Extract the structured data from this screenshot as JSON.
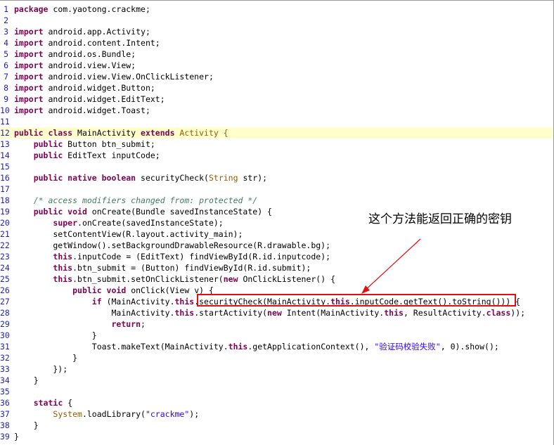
{
  "editor": {
    "lines": [
      {
        "n": "1",
        "parts": [
          [
            "kw",
            "package"
          ],
          [
            "pl",
            " com.yaotong.crackme;"
          ]
        ]
      },
      {
        "n": "2",
        "parts": []
      },
      {
        "n": "3",
        "parts": [
          [
            "kw",
            "import"
          ],
          [
            "pl",
            " android.app.Activity;"
          ]
        ]
      },
      {
        "n": "4",
        "parts": [
          [
            "kw",
            "import"
          ],
          [
            "pl",
            " android.content.Intent;"
          ]
        ]
      },
      {
        "n": "5",
        "parts": [
          [
            "kw",
            "import"
          ],
          [
            "pl",
            " android.os.Bundle;"
          ]
        ]
      },
      {
        "n": "6",
        "parts": [
          [
            "kw",
            "import"
          ],
          [
            "pl",
            " android.view.View;"
          ]
        ]
      },
      {
        "n": "7",
        "parts": [
          [
            "kw",
            "import"
          ],
          [
            "pl",
            " android.view.View.OnClickListener;"
          ]
        ]
      },
      {
        "n": "8",
        "parts": [
          [
            "kw",
            "import"
          ],
          [
            "pl",
            " android.widget.Button;"
          ]
        ]
      },
      {
        "n": "9",
        "parts": [
          [
            "kw",
            "import"
          ],
          [
            "pl",
            " android.widget.EditText;"
          ]
        ]
      },
      {
        "n": "10",
        "parts": [
          [
            "kw",
            "import"
          ],
          [
            "pl",
            " android.widget.Toast;"
          ]
        ]
      },
      {
        "n": "11",
        "parts": []
      },
      {
        "n": "12",
        "hl": true,
        "parts": [
          [
            "kw",
            "public class"
          ],
          [
            "pl",
            " MainActivity "
          ],
          [
            "kw",
            "extends"
          ],
          [
            "an",
            " Activity {"
          ]
        ]
      },
      {
        "n": "13",
        "parts": [
          [
            "pl",
            "    "
          ],
          [
            "kw",
            "public"
          ],
          [
            "pl",
            " Button btn_submit;"
          ]
        ]
      },
      {
        "n": "14",
        "parts": [
          [
            "pl",
            "    "
          ],
          [
            "kw",
            "public"
          ],
          [
            "pl",
            " EditText inputCode;"
          ]
        ]
      },
      {
        "n": "15",
        "parts": []
      },
      {
        "n": "16",
        "parts": [
          [
            "pl",
            "    "
          ],
          [
            "kw",
            "public native boolean"
          ],
          [
            "pl",
            " securityCheck("
          ],
          [
            "an",
            "String"
          ],
          [
            "pl",
            " str);"
          ]
        ]
      },
      {
        "n": "17",
        "parts": []
      },
      {
        "n": "18",
        "parts": [
          [
            "pl",
            "    "
          ],
          [
            "cm",
            "/* access modifiers changed from: protected */"
          ]
        ]
      },
      {
        "n": "19",
        "parts": [
          [
            "pl",
            "    "
          ],
          [
            "kw",
            "public void"
          ],
          [
            "pl",
            " onCreate(Bundle savedInstanceState) {"
          ]
        ]
      },
      {
        "n": "20",
        "parts": [
          [
            "pl",
            "        "
          ],
          [
            "kw",
            "super"
          ],
          [
            "pl",
            ".onCreate(savedInstanceState);"
          ]
        ]
      },
      {
        "n": "21",
        "parts": [
          [
            "pl",
            "        setContentView(R.layout.activity_main);"
          ]
        ]
      },
      {
        "n": "22",
        "parts": [
          [
            "pl",
            "        getWindow().setBackgroundDrawableResource(R.drawable.bg);"
          ]
        ]
      },
      {
        "n": "23",
        "parts": [
          [
            "pl",
            "        "
          ],
          [
            "kw",
            "this"
          ],
          [
            "pl",
            ".inputCode = (EditText) findViewById(R.id.inputcode);"
          ]
        ]
      },
      {
        "n": "24",
        "parts": [
          [
            "pl",
            "        "
          ],
          [
            "kw",
            "this"
          ],
          [
            "pl",
            ".btn_submit = (Button) findViewById(R.id.submit);"
          ]
        ]
      },
      {
        "n": "25",
        "parts": [
          [
            "pl",
            "        "
          ],
          [
            "kw",
            "this"
          ],
          [
            "pl",
            ".btn_submit.setOnClickListener("
          ],
          [
            "kw",
            "new"
          ],
          [
            "pl",
            " OnClickListener() {"
          ]
        ]
      },
      {
        "n": "26",
        "parts": [
          [
            "pl",
            "            "
          ],
          [
            "kw",
            "public void"
          ],
          [
            "pl",
            " onClick(View v) {"
          ]
        ]
      },
      {
        "n": "27",
        "parts": [
          [
            "pl",
            "                "
          ],
          [
            "kw",
            "if"
          ],
          [
            "pl",
            " (MainActivity."
          ],
          [
            "kw",
            "this"
          ],
          [
            "pl",
            ".securityCheck(MainActivity."
          ],
          [
            "kw",
            "this"
          ],
          [
            "pl",
            ".inputCode.getText().toString())) {"
          ]
        ]
      },
      {
        "n": "28",
        "parts": [
          [
            "pl",
            "                    MainActivity."
          ],
          [
            "kw",
            "this"
          ],
          [
            "pl",
            ".startActivity("
          ],
          [
            "kw",
            "new"
          ],
          [
            "pl",
            " Intent(MainActivity."
          ],
          [
            "kw",
            "this"
          ],
          [
            "pl",
            ", ResultActivity."
          ],
          [
            "kw",
            "class"
          ],
          [
            "pl",
            "));"
          ]
        ]
      },
      {
        "n": "29",
        "parts": [
          [
            "pl",
            "                    "
          ],
          [
            "kw",
            "return"
          ],
          [
            "pl",
            ";"
          ]
        ]
      },
      {
        "n": "30",
        "parts": [
          [
            "pl",
            "                }"
          ]
        ]
      },
      {
        "n": "31",
        "parts": [
          [
            "pl",
            "                Toast.makeText(MainActivity."
          ],
          [
            "kw",
            "this"
          ],
          [
            "pl",
            ".getApplicationContext(), "
          ],
          [
            "st",
            "\"验证码校验失败\""
          ],
          [
            "pl",
            ", 0).show();"
          ]
        ]
      },
      {
        "n": "32",
        "parts": [
          [
            "pl",
            "            }"
          ]
        ]
      },
      {
        "n": "33",
        "parts": [
          [
            "pl",
            "        });"
          ]
        ]
      },
      {
        "n": "34",
        "parts": [
          [
            "pl",
            "    }"
          ]
        ]
      },
      {
        "n": "35",
        "parts": []
      },
      {
        "n": "36",
        "parts": [
          [
            "pl",
            "    "
          ],
          [
            "kw",
            "static"
          ],
          [
            "pl",
            " {"
          ]
        ]
      },
      {
        "n": "37",
        "parts": [
          [
            "pl",
            "        "
          ],
          [
            "an",
            "System"
          ],
          [
            "pl",
            ".loadLibrary("
          ],
          [
            "st",
            "\"crackme\""
          ],
          [
            "pl",
            ");"
          ]
        ]
      },
      {
        "n": "38",
        "parts": [
          [
            "pl",
            "    }"
          ]
        ]
      },
      {
        "n": "39",
        "parts": [
          [
            "pl",
            "}"
          ]
        ]
      }
    ]
  },
  "annotation": {
    "label": "这个方法能返回正确的密钥",
    "color": "#e01010"
  }
}
